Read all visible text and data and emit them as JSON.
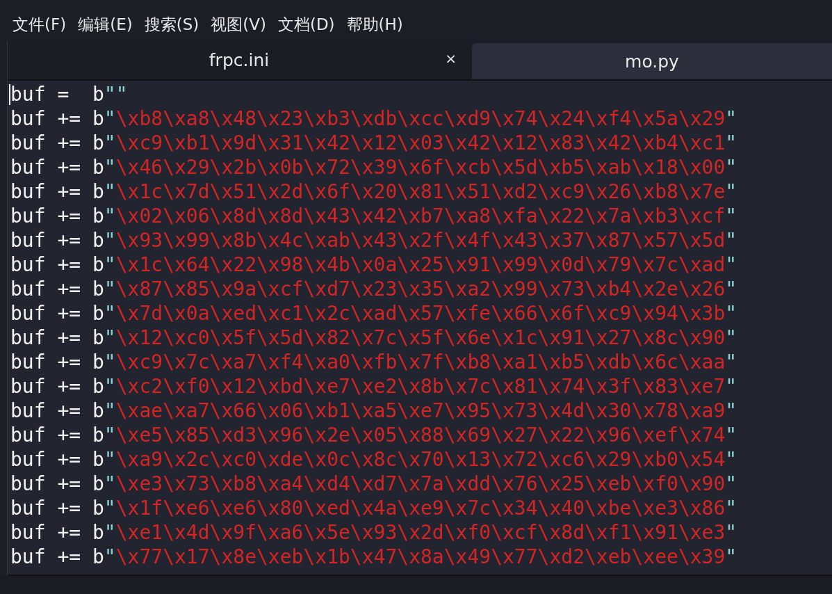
{
  "menu": [
    "文件(F)",
    "编辑(E)",
    "搜索(S)",
    "视图(V)",
    "文档(D)",
    "帮助(H)"
  ],
  "tabs": [
    {
      "label": "frpc.ini",
      "close": "×",
      "selected": false
    },
    {
      "label": "mo.py",
      "selected": true
    }
  ],
  "lines": [
    {
      "code": "buf =  b",
      "open": "\"",
      "close": "\""
    },
    {
      "code": "buf += b",
      "open": "\"",
      "bytes": "\\xb8\\xa8\\x48\\x23\\xb3\\xdb\\xcc\\xd9\\x74\\x24\\xf4\\x5a\\x29",
      "close": "\""
    },
    {
      "code": "buf += b",
      "open": "\"",
      "bytes": "\\xc9\\xb1\\x9d\\x31\\x42\\x12\\x03\\x42\\x12\\x83\\x42\\xb4\\xc1",
      "close": "\""
    },
    {
      "code": "buf += b",
      "open": "\"",
      "bytes": "\\x46\\x29\\x2b\\x0b\\x72\\x39\\x6f\\xcb\\x5d\\xb5\\xab\\x18\\x00",
      "close": "\""
    },
    {
      "code": "buf += b",
      "open": "\"",
      "bytes": "\\x1c\\x7d\\x51\\x2d\\x6f\\x20\\x81\\x51\\xd2\\xc9\\x26\\xb8\\x7e",
      "close": "\""
    },
    {
      "code": "buf += b",
      "open": "\"",
      "bytes": "\\x02\\x06\\x8d\\x8d\\x43\\x42\\xb7\\xa8\\xfa\\x22\\x7a\\xb3\\xcf",
      "close": "\""
    },
    {
      "code": "buf += b",
      "open": "\"",
      "bytes": "\\x93\\x99\\x8b\\x4c\\xab\\x43\\x2f\\x4f\\x43\\x37\\x87\\x57\\x5d",
      "close": "\""
    },
    {
      "code": "buf += b",
      "open": "\"",
      "bytes": "\\x1c\\x64\\x22\\x98\\x4b\\x0a\\x25\\x91\\x99\\x0d\\x79\\x7c\\xad",
      "close": "\""
    },
    {
      "code": "buf += b",
      "open": "\"",
      "bytes": "\\x87\\x85\\x9a\\xcf\\xd7\\x23\\x35\\xa2\\x99\\x73\\xb4\\x2e\\x26",
      "close": "\""
    },
    {
      "code": "buf += b",
      "open": "\"",
      "bytes": "\\x7d\\x0a\\xed\\xc1\\x2c\\xad\\x57\\xfe\\x66\\x6f\\xc9\\x94\\x3b",
      "close": "\""
    },
    {
      "code": "buf += b",
      "open": "\"",
      "bytes": "\\x12\\xc0\\x5f\\x5d\\x82\\x7c\\x5f\\x6e\\x1c\\x91\\x27\\x8c\\x90",
      "close": "\""
    },
    {
      "code": "buf += b",
      "open": "\"",
      "bytes": "\\xc9\\x7c\\xa7\\xf4\\xa0\\xfb\\x7f\\xb8\\xa1\\xb5\\xdb\\x6c\\xaa",
      "close": "\""
    },
    {
      "code": "buf += b",
      "open": "\"",
      "bytes": "\\xc2\\xf0\\x12\\xbd\\xe7\\xe2\\x8b\\x7c\\x81\\x74\\x3f\\x83\\xe7",
      "close": "\""
    },
    {
      "code": "buf += b",
      "open": "\"",
      "bytes": "\\xae\\xa7\\x66\\x06\\xb1\\xa5\\xe7\\x95\\x73\\x4d\\x30\\x78\\xa9",
      "close": "\""
    },
    {
      "code": "buf += b",
      "open": "\"",
      "bytes": "\\xe5\\x85\\xd3\\x96\\x2e\\x05\\x88\\x69\\x27\\x22\\x96\\xef\\x74",
      "close": "\""
    },
    {
      "code": "buf += b",
      "open": "\"",
      "bytes": "\\xa9\\x2c\\xc0\\xde\\x0c\\x8c\\x70\\x13\\x72\\xc6\\x29\\xb0\\x54",
      "close": "\""
    },
    {
      "code": "buf += b",
      "open": "\"",
      "bytes": "\\xe3\\x73\\xb8\\xa4\\xd4\\xd7\\x7a\\xdd\\x76\\x25\\xeb\\xf0\\x90",
      "close": "\""
    },
    {
      "code": "buf += b",
      "open": "\"",
      "bytes": "\\x1f\\xe6\\xe6\\x80\\xed\\x4a\\xe9\\x7c\\x34\\x40\\xbe\\xe3\\x86",
      "close": "\""
    },
    {
      "code": "buf += b",
      "open": "\"",
      "bytes": "\\xe1\\x4d\\x9f\\xa6\\x5e\\x93\\x2d\\xf0\\xcf\\x8d\\xf1\\x91\\xe3",
      "close": "\""
    },
    {
      "code": "buf += b",
      "open": "\"",
      "bytes": "\\x77\\x17\\x8e\\xeb\\x1b\\x47\\x8a\\x49\\x77\\xd2\\xeb\\xee\\x39",
      "close": "\""
    }
  ]
}
